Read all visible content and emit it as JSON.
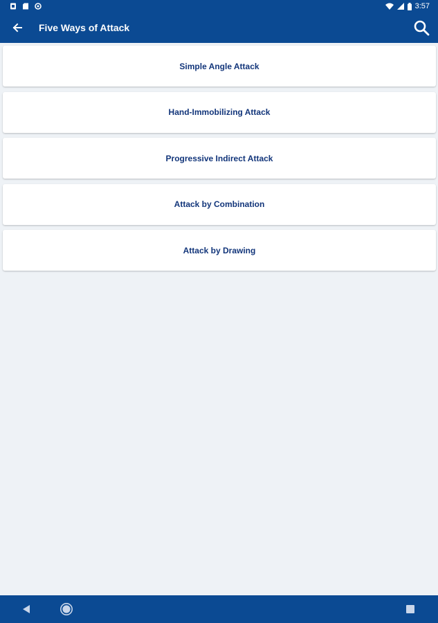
{
  "status_bar": {
    "time": "3:57",
    "notification_icons": [
      "sim-card-icon",
      "sd-card-icon",
      "sync-icon"
    ],
    "system_icons": [
      "wifi-icon",
      "signal-icon",
      "battery-icon"
    ]
  },
  "app_bar": {
    "title": "Five Ways of Attack",
    "back_icon": "arrow-left-icon",
    "search_icon": "search-icon"
  },
  "list": {
    "items": [
      {
        "label": "Simple Angle Attack"
      },
      {
        "label": "Hand-Immobilizing Attack"
      },
      {
        "label": "Progressive Indirect Attack"
      },
      {
        "label": "Attack by Combination"
      },
      {
        "label": "Attack by Drawing"
      }
    ]
  },
  "nav_bar": {
    "buttons": [
      "nav-back-icon",
      "nav-home-icon",
      "nav-recents-icon"
    ]
  },
  "colors": {
    "primary": "#0b4a93",
    "background": "#eef2f6",
    "card": "#ffffff",
    "card_text": "#12357a"
  }
}
